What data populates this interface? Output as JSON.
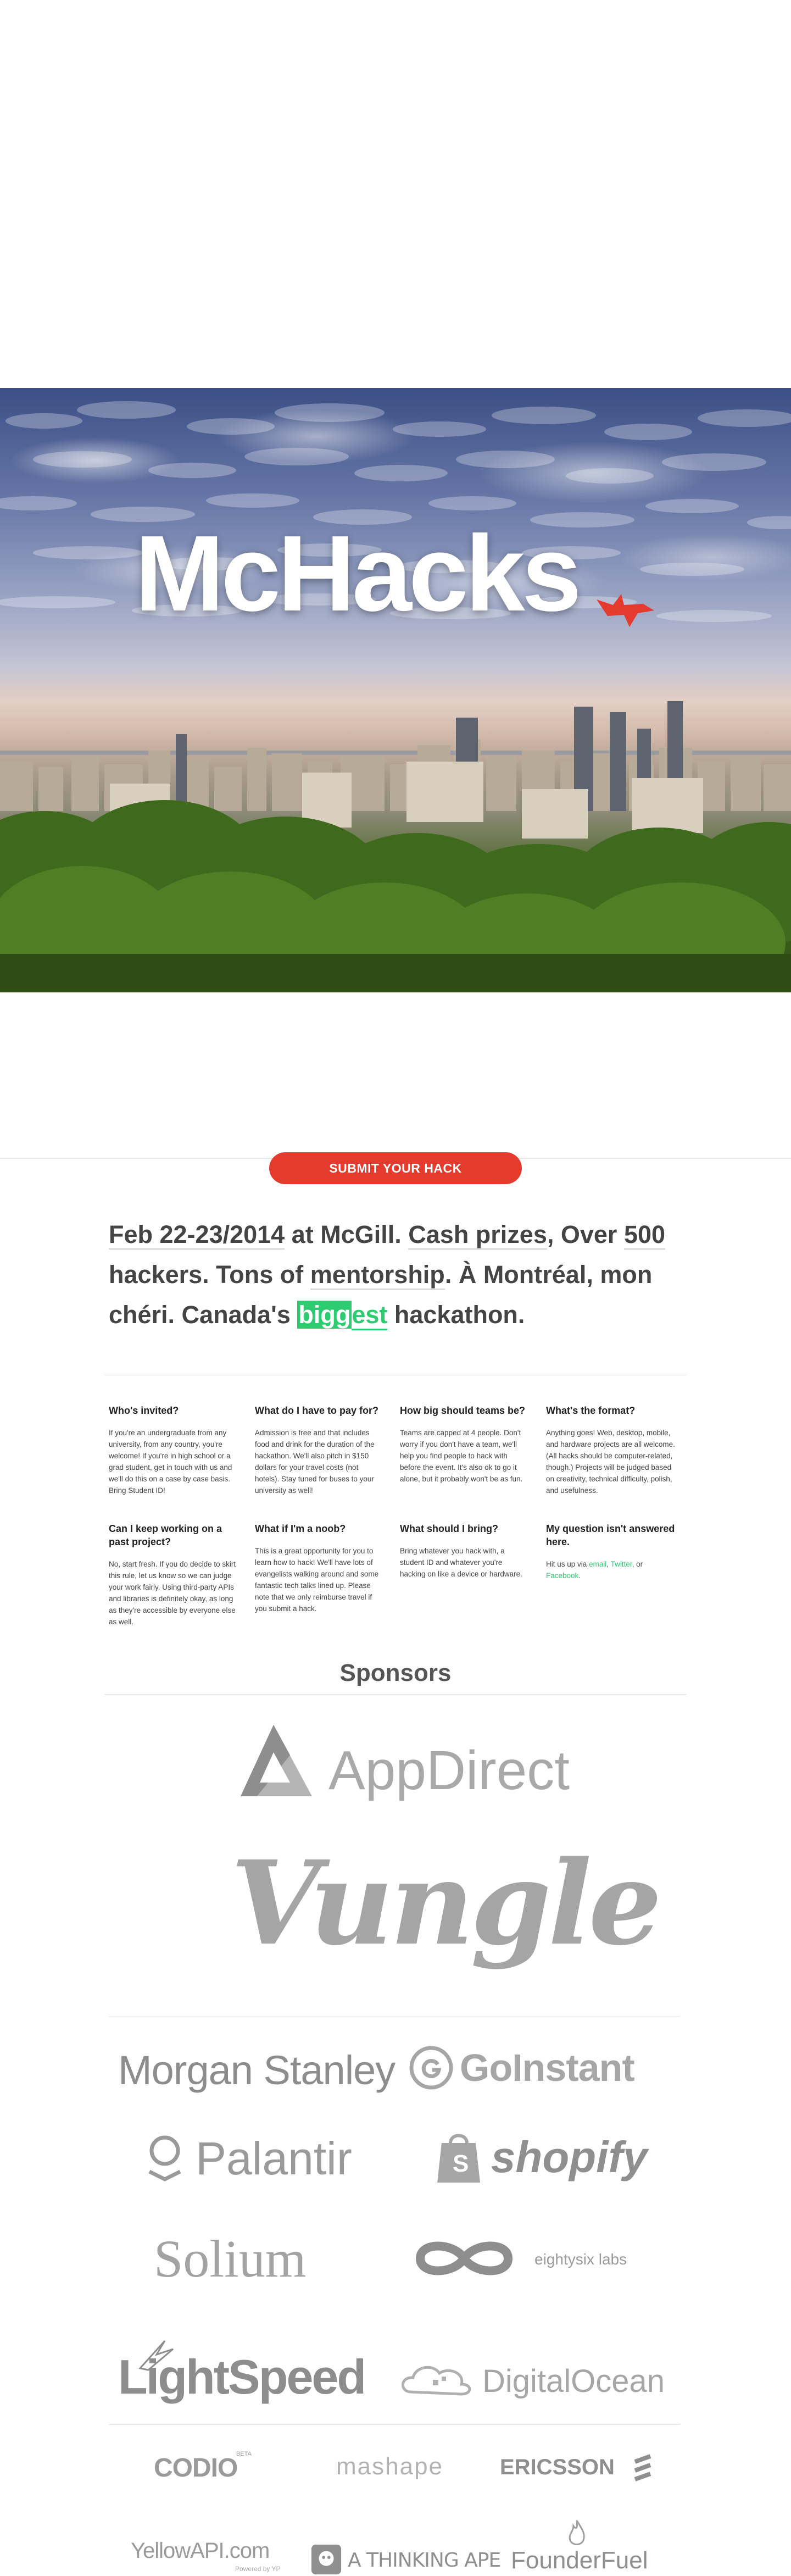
{
  "hero": {
    "title": "McHacks"
  },
  "nav": {
    "submit_label": "SUBMIT YOUR HACK"
  },
  "intro": {
    "part1": "Feb 22-23/2014",
    "part2": " at McGill. ",
    "part3": "Cash prizes",
    "part4": ", Over ",
    "part5": "500",
    "part6": " hackers. Tons of ",
    "part7": "mentorship",
    "part8": ". À Montréal, mon chéri. Canada's ",
    "part9a": "bigg",
    "part9b": "est",
    "part10": " hackathon."
  },
  "faq": [
    {
      "q": "Who's invited?",
      "a": "If you're an undergraduate from any university, from any country, you're welcome! If you're in high school or a grad student, get in touch with us and we'll do this on a case by case basis. Bring Student ID!"
    },
    {
      "q": "What do I have to pay for?",
      "a": "Admission is free and that includes food and drink for the duration of the hackathon. We'll also pitch in $150 dollars for your travel costs (not hotels). Stay tuned for buses to your university as well!"
    },
    {
      "q": "How big should teams be?",
      "a": "Teams are capped at 4 people. Don't worry if you don't have a team, we'll help you find people to hack with before the event. It's also ok to go it alone, but it probably won't be as fun."
    },
    {
      "q": "What's the format?",
      "a": "Anything goes! Web, desktop, mobile, and hardware projects are all welcome. (All hacks should be computer-related, though.) Projects will be judged based on creativity, technical difficulty, polish, and usefulness."
    },
    {
      "q": "Can I keep working on a past project?",
      "a": "No, start fresh. If you do decide to skirt this rule, let us know so we can judge your work fairly. Using third-party APIs and libraries is definitely okay, as long as they're accessible by everyone else as well."
    },
    {
      "q": "What if I'm a noob?",
      "a": "This is a great opportunity for you to learn how to hack! We'll have lots of evangelists walking around and some fantastic tech talks lined up. Please note that we only reimburse travel if you submit a hack."
    },
    {
      "q": "What should I bring?",
      "a": "Bring whatever you hack with, a student ID and whatever you're hacking on like a device or hardware."
    },
    {
      "q": "My question isn't answered here.",
      "a_pre": "Hit us up via ",
      "email": "email",
      "sep1": ", ",
      "twitter": "Twitter",
      "sep2": ", or ",
      "facebook": "Facebook",
      "end": "."
    }
  ],
  "sponsors": {
    "title": "Sponsors",
    "appdirect": "AppDirect",
    "vungle": "Vungle",
    "morgan": "Morgan Stanley",
    "goinstant": "GoInstant",
    "palantir": "Palantir",
    "shopify": "shopify",
    "solium": "Solium",
    "eightysix": "eightysix labs",
    "lightspeed": "LightSpeed",
    "digitalocean": "DigitalOcean",
    "codio": "CODIO",
    "codio_beta": "BETA",
    "mashape": "mashape",
    "ericsson": "ERICSSON",
    "yellowapi": "YellowAPI.com",
    "yellowapi_sub": "Powered by YP",
    "thinkingape": "A THINKING APE",
    "founderfuel": "FounderFuel"
  },
  "colors": {
    "accent_red": "#e53b2f",
    "accent_green": "#2ecc71",
    "logo_gray": "#9a9a9a"
  }
}
